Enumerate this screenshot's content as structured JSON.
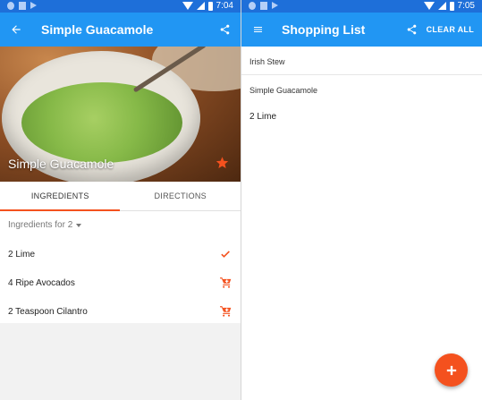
{
  "status_bar": {
    "left_time": "7:04",
    "right_time": "7:05"
  },
  "recipe_screen": {
    "title": "Simple Guacamole",
    "hero_title": "Simple Guacamole",
    "tabs": [
      {
        "label": "INGREDIENTS",
        "active": true
      },
      {
        "label": "DIRECTIONS",
        "active": false
      }
    ],
    "ingredients_for": "Ingredients for 2",
    "ingredients": [
      {
        "label": "2 Lime",
        "action_icon": "check-icon"
      },
      {
        "label": "4 Ripe Avocados",
        "action_icon": "add-to-cart-icon"
      },
      {
        "label": "2 Teaspoon Cilantro",
        "action_icon": "add-to-cart-icon"
      }
    ]
  },
  "shopping_list_screen": {
    "title": "Shopping List",
    "clear_all_label": "CLEAR ALL",
    "recipes": [
      {
        "name": "Irish Stew"
      },
      {
        "name": "Simple Guacamole",
        "items": [
          "2 Lime"
        ]
      }
    ]
  },
  "colors": {
    "appbar": "#2196f3",
    "statusbar": "#1e6fd9",
    "accent": "#f4511e"
  }
}
